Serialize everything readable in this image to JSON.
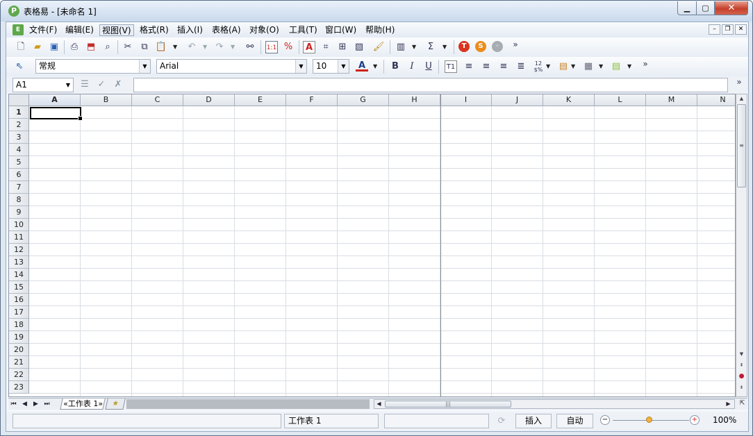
{
  "window": {
    "title": "表格易 - [未命名 1]",
    "app_icon_letter": "P"
  },
  "menus": [
    "文件(F)",
    "编辑(E)",
    "视图(V)",
    "格式(R)",
    "插入(I)",
    "表格(A)",
    "对象(O)",
    "工具(T)",
    "窗口(W)",
    "帮助(H)"
  ],
  "format_toolbar": {
    "style": "常规",
    "font": "Arial",
    "size": "10"
  },
  "formula_bar": {
    "cell_ref": "A1",
    "content": ""
  },
  "grid": {
    "columns": [
      "A",
      "B",
      "C",
      "D",
      "E",
      "F",
      "G",
      "H",
      "I",
      "J",
      "K",
      "L",
      "M",
      "N"
    ],
    "rows": [
      "1",
      "2",
      "3",
      "4",
      "5",
      "6",
      "7",
      "8",
      "9",
      "10",
      "11",
      "12",
      "13",
      "14",
      "15",
      "16",
      "17",
      "18",
      "19",
      "20",
      "21",
      "22",
      "23"
    ],
    "active_column": "A",
    "active_row": "1"
  },
  "sheet_tabs": [
    "«工作表 1»"
  ],
  "status": {
    "sheet": "工作表 1",
    "mode_insert": "插入",
    "mode_auto": "自动",
    "zoom": "100%"
  },
  "colors": {
    "accent_close": "#c4402b",
    "zoom_knob": "#f2b33d",
    "app_green": "#5fa84a"
  }
}
